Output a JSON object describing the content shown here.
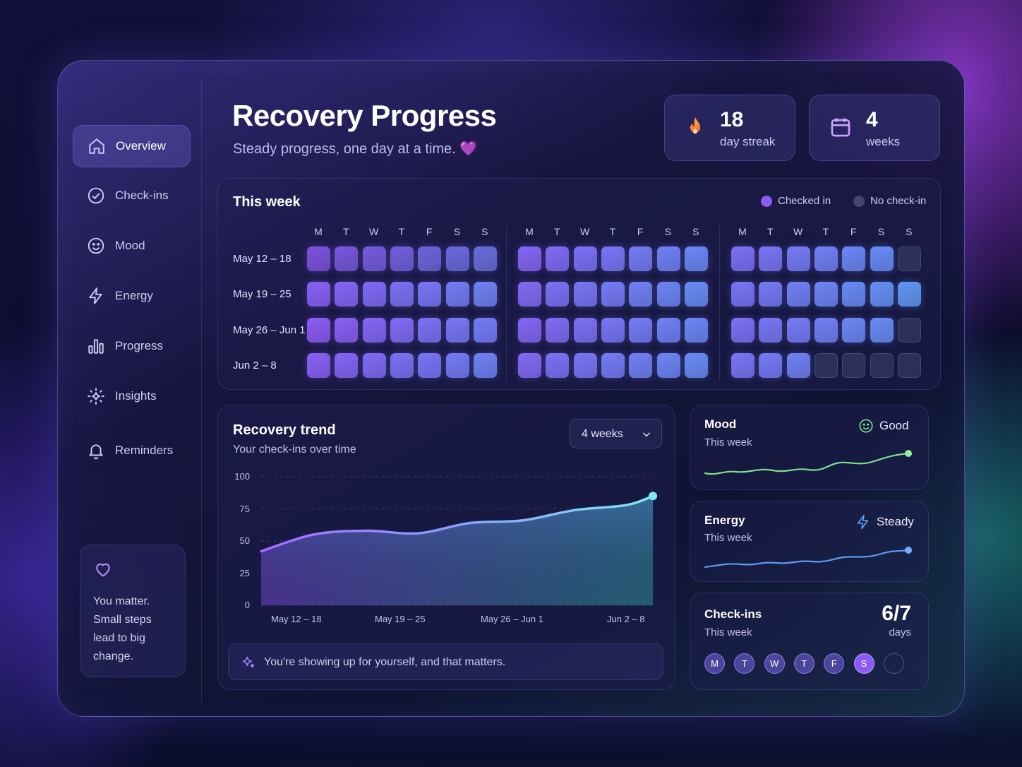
{
  "nav": {
    "items": [
      {
        "label": "Overview",
        "icon": "home-icon",
        "active": true
      },
      {
        "label": "Check-ins",
        "icon": "check-circle-icon"
      },
      {
        "label": "Mood",
        "icon": "smile-icon"
      },
      {
        "label": "Energy",
        "icon": "lightning-icon"
      },
      {
        "label": "Progress",
        "icon": "bar-chart-icon"
      },
      {
        "label": "Insights",
        "icon": "sparkle-icon"
      },
      {
        "label": "Reminders",
        "icon": "bell-icon"
      }
    ]
  },
  "encouragement": {
    "icon": "heart-icon",
    "text": "You matter. Small steps lead to big change."
  },
  "header": {
    "title": "Recovery Progress",
    "subtitle": "Steady progress, one day at a time. 💜"
  },
  "stats": {
    "streak": {
      "value": "18",
      "label": "day streak",
      "icon": "flame-icon"
    },
    "weeks": {
      "value": "4",
      "label": "weeks",
      "icon": "calendar-icon"
    }
  },
  "this_week": {
    "title": "This week",
    "legend": {
      "checked": "Checked in",
      "none": "No check-in"
    },
    "day_headers": [
      "M",
      "T",
      "W",
      "T",
      "F",
      "S",
      "S"
    ],
    "rows": [
      "May 12 – 18",
      "May 19 – 25",
      "May 26 – Jun 1",
      "Jun 2 – 8"
    ],
    "grid": [
      [
        [
          1,
          1,
          1,
          1,
          1,
          1,
          1
        ],
        [
          1,
          1,
          1,
          1,
          1,
          1,
          1
        ],
        [
          1,
          1,
          1,
          1,
          1,
          1,
          0
        ]
      ],
      [
        [
          1,
          1,
          1,
          1,
          1,
          1,
          1
        ],
        [
          1,
          1,
          1,
          1,
          1,
          1,
          1
        ],
        [
          1,
          1,
          1,
          1,
          1,
          1,
          1
        ]
      ],
      [
        [
          1,
          1,
          1,
          1,
          1,
          1,
          1
        ],
        [
          1,
          1,
          1,
          1,
          1,
          1,
          1
        ],
        [
          1,
          1,
          1,
          1,
          1,
          1,
          0
        ]
      ],
      [
        [
          1,
          1,
          1,
          1,
          1,
          1,
          1
        ],
        [
          1,
          1,
          1,
          1,
          1,
          1,
          1
        ],
        [
          1,
          1,
          1,
          0,
          0,
          0,
          0
        ]
      ]
    ]
  },
  "trend": {
    "title": "Recovery trend",
    "subtitle": "Your check-ins over time",
    "range_select": "4 weeks",
    "note": "You're showing up for yourself, and that matters."
  },
  "chart_data": {
    "type": "area",
    "categories": [
      "May 12 – 18",
      "May 19 – 25",
      "May 26 – Jun 1",
      "Jun 2 – 8"
    ],
    "y_ticks": [
      100,
      75,
      50,
      25,
      0
    ],
    "ylim": [
      0,
      100
    ],
    "x": [
      0,
      0.5,
      1,
      1.5,
      2,
      2.5,
      3,
      3.5,
      3.75
    ],
    "values": [
      42,
      55,
      58,
      56,
      64,
      66,
      74,
      78,
      85
    ],
    "grid": true
  },
  "mood": {
    "title": "Mood",
    "sub": "This week",
    "status": "Good",
    "icon": "smile-icon",
    "color": "#7ee08a"
  },
  "energy": {
    "title": "Energy",
    "sub": "This week",
    "status": "Steady",
    "icon": "lightning-icon",
    "color": "#5b9cf5"
  },
  "checkins": {
    "title": "Check-ins",
    "sub": "This week",
    "value": "6/7",
    "unit": "days",
    "days": [
      {
        "d": "M",
        "state": "on"
      },
      {
        "d": "T",
        "state": "on"
      },
      {
        "d": "W",
        "state": "on"
      },
      {
        "d": "T",
        "state": "on"
      },
      {
        "d": "F",
        "state": "on"
      },
      {
        "d": "S",
        "state": "today"
      },
      {
        "d": "",
        "state": "off"
      }
    ]
  },
  "colors": {
    "accent": "#8a5cf5",
    "blue": "#5ea6f5",
    "teal": "#4fd1c5"
  }
}
